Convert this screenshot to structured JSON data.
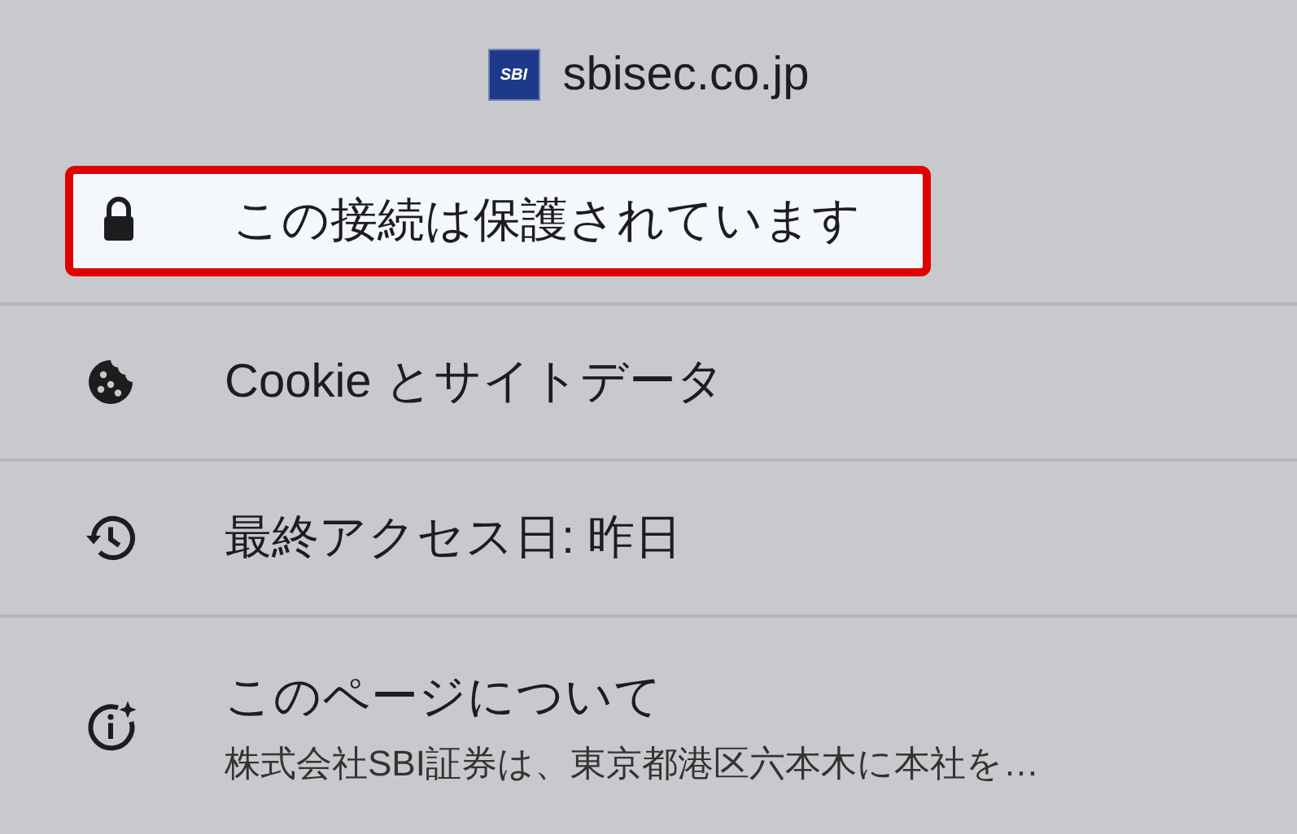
{
  "site": {
    "domain": "sbisec.co.jp",
    "logo_text": "SBI"
  },
  "items": [
    {
      "kind": "lock",
      "title": "この接続は保護されています",
      "highlighted": true
    },
    {
      "kind": "cookie",
      "title": "Cookie とサイトデータ",
      "highlighted": false
    },
    {
      "kind": "history",
      "title": "最終アクセス日: 昨日",
      "highlighted": false
    },
    {
      "kind": "info",
      "title": "このページについて",
      "subtitle": "株式会社SBI証券は、東京都港区六本木に本社を…",
      "highlighted": false
    }
  ]
}
